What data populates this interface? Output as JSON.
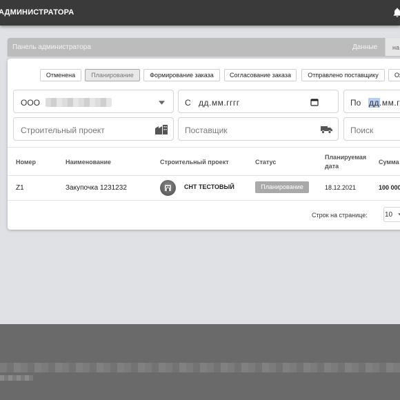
{
  "topbar": {
    "title": "АДМИНИСТРАТОРА"
  },
  "panel": {
    "title": "Панель администратора",
    "data_label": "Данные",
    "tab_label": "на р"
  },
  "filters": {
    "chips": [
      {
        "label": "Отменена",
        "active": false
      },
      {
        "label": "Планирование",
        "active": true
      },
      {
        "label": "Формирование заказа",
        "active": false
      },
      {
        "label": "Согласование заказа",
        "active": false
      },
      {
        "label": "Отправлено поставщику",
        "active": false
      },
      {
        "label": "Ож",
        "active": false
      }
    ],
    "company_value": "ООО",
    "date_from_prefix": "С",
    "date_from_placeholder": "дд.мм.гггг",
    "date_to_prefix": "По",
    "date_to_placeholder_sel": "дд",
    "date_to_placeholder_rest": ".мм.гг",
    "project_placeholder": "Строительный проект",
    "supplier_placeholder": "Поставщик",
    "search_placeholder": "Поиск"
  },
  "table": {
    "headers": {
      "number": "Номер",
      "name": "Наименование",
      "project": "Строительный проект",
      "status": "Статус",
      "planned_line1": "Планируемая",
      "planned_line2": "дата",
      "sum": "Сумма"
    },
    "rows": [
      {
        "number": "Z1",
        "name": "Закупочка 1231232",
        "project": "СНТ ТЕСТОВЫЙ",
        "status": "Планирование",
        "date": "18.12.2021",
        "sum": "100 000"
      }
    ],
    "rows_per_page_label": "Строк на странице:",
    "rows_per_page_value": "10"
  },
  "icons": {
    "bell": "bell-icon",
    "dropdown": "chevron-down-icon",
    "calendar": "calendar-icon",
    "building": "building-icon",
    "truck": "truck-icon"
  }
}
